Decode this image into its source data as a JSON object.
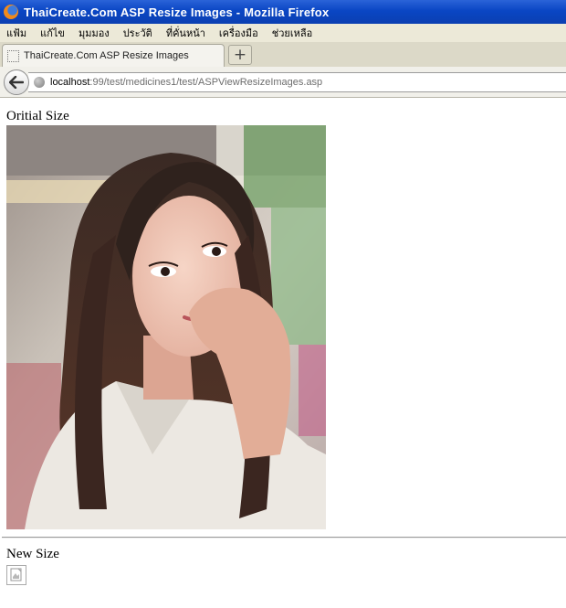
{
  "window": {
    "title": "ThaiCreate.Com ASP Resize Images - Mozilla Firefox"
  },
  "menu": [
    "แฟ้ม",
    "แก้ไข",
    "มุมมอง",
    "ประวัติ",
    "ที่คั่นหน้า",
    "เครื่องมือ",
    "ช่วยเหลือ"
  ],
  "tab": {
    "label": "ThaiCreate.Com ASP Resize Images",
    "new_tab_label": "+"
  },
  "address": {
    "host": "localhost",
    "rest": ":99/test/medicines1/test/ASPViewResizeImages.asp"
  },
  "page": {
    "original_heading": "Oritial Size",
    "new_heading": "New Size"
  },
  "icons": {
    "app": "firefox-icon",
    "back": "back-arrow-icon",
    "site": "globe-icon",
    "broken_image": "broken-image-icon"
  }
}
